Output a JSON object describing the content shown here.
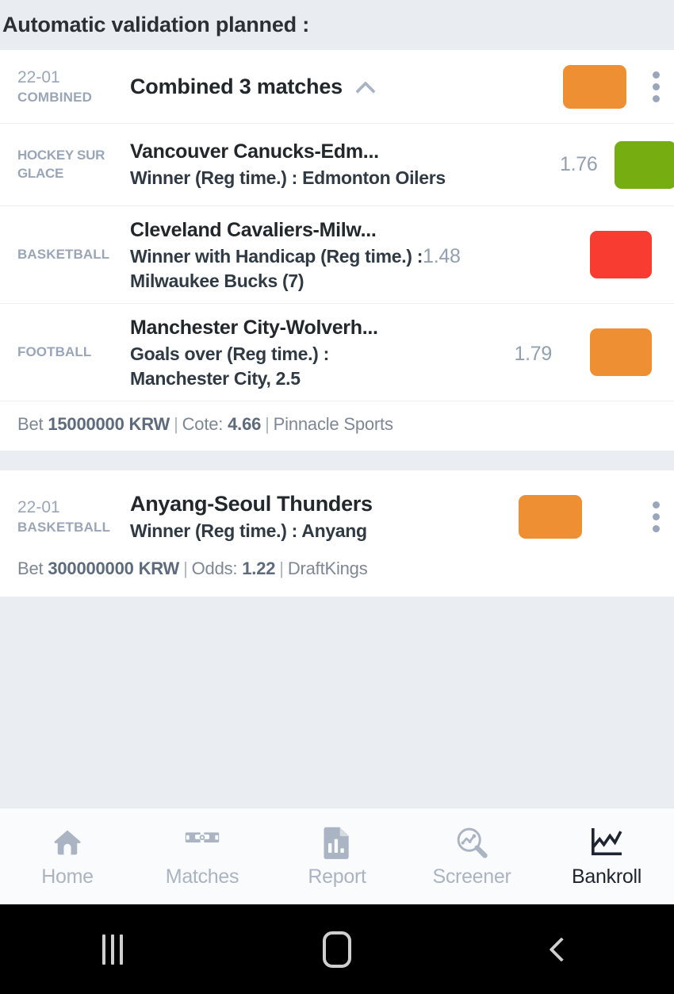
{
  "header": {
    "title": "Automatic validation planned :"
  },
  "combined_card": {
    "date": "22-01",
    "category": "COMBINED",
    "title": "Combined 3 matches",
    "collapse_icon": "chevron-up-icon",
    "status_color": "#ef8f33",
    "menu_icon": "kebab-menu-icon",
    "matches": [
      {
        "sport": "HOCKEY SUR GLACE",
        "title": "Vancouver Canucks-Edm...",
        "bet": "Winner (Reg time.) : Edmonton Oilers",
        "odd": "1.76",
        "status_color": "#76ad11"
      },
      {
        "sport": "BASKETBALL",
        "title": "Cleveland Cavaliers-Milw...",
        "bet": "Winner with Handicap (Reg time.) :",
        "bet_line2": "Milwaukee Bucks (7)",
        "odd": "1.48",
        "status_color": "#f83c32"
      },
      {
        "sport": "FOOTBALL",
        "title": "Manchester City-Wolverh...",
        "bet": "Goals over (Reg time.) :",
        "bet_line2": "Manchester City, 2.5",
        "odd": "1.79",
        "status_color": "#ef8f33"
      }
    ],
    "footer": {
      "bet_label": "Bet",
      "bet_amount": "15000000 KRW",
      "odds_label": "Cote:",
      "odds_value": "4.66",
      "bookmaker": "Pinnacle Sports",
      "separator": "|"
    }
  },
  "single_card": {
    "date": "22-01",
    "category": "BASKETBALL",
    "title": "Anyang-Seoul Thunders",
    "bet": "Winner (Reg time.) : Anyang",
    "status_color": "#ef8f33",
    "menu_icon": "kebab-menu-icon",
    "footer": {
      "bet_label": "Bet",
      "bet_amount": "300000000 KRW",
      "odds_label": "Odds:",
      "odds_value": "1.22",
      "bookmaker": "DraftKings",
      "separator": "|"
    }
  },
  "bottom_nav": {
    "items": [
      {
        "label": "Home",
        "icon": "home-icon",
        "active": false
      },
      {
        "label": "Matches",
        "icon": "pitch-icon",
        "active": false
      },
      {
        "label": "Report",
        "icon": "document-chart-icon",
        "active": false
      },
      {
        "label": "Screener",
        "icon": "magnifier-chart-icon",
        "active": false
      },
      {
        "label": "Bankroll",
        "icon": "line-chart-icon",
        "active": true
      }
    ],
    "inactive_color": "#aab4c2",
    "active_color": "#1e2430"
  },
  "system_bar": {
    "recents": "recents-icon",
    "home": "home-square-icon",
    "back": "back-chevron-icon"
  }
}
